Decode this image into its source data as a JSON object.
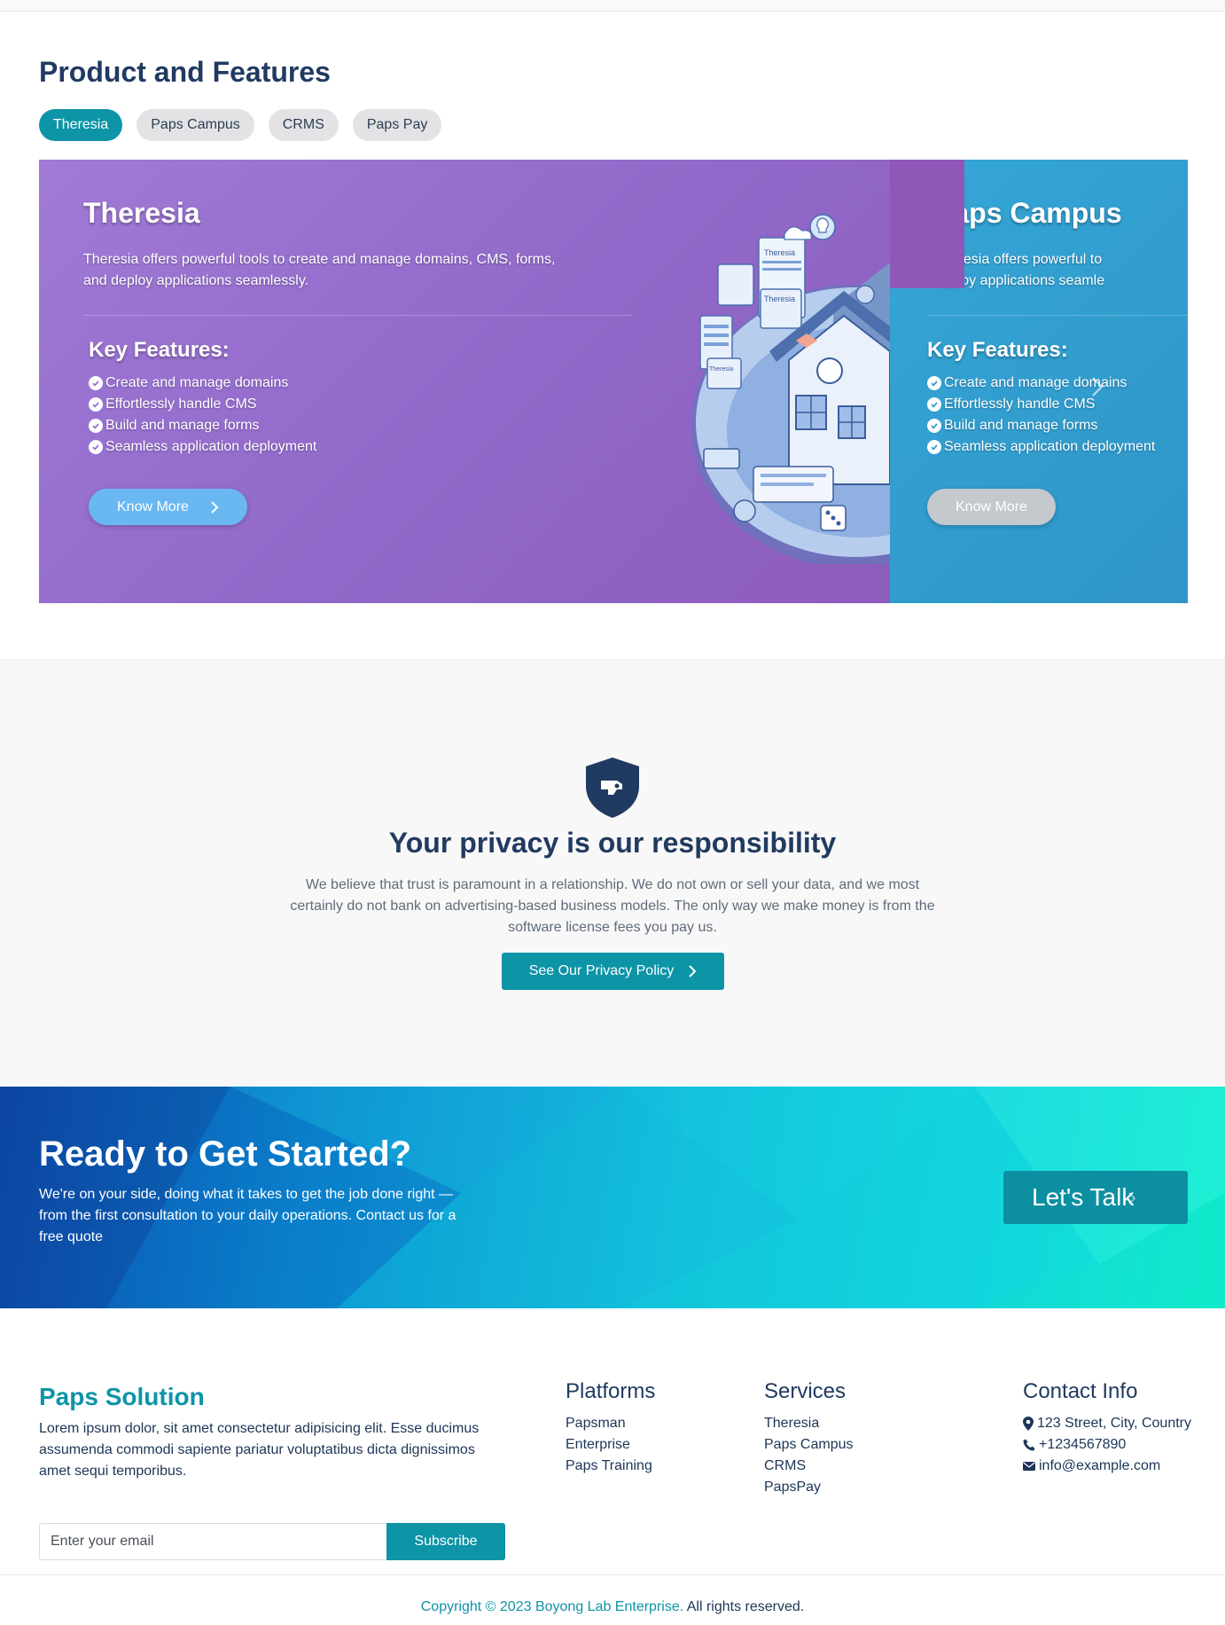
{
  "products": {
    "title": "Product and Features",
    "tabs": [
      {
        "label": "Theresia",
        "active": true
      },
      {
        "label": "Paps Campus",
        "active": false
      },
      {
        "label": "CRMS",
        "active": false
      },
      {
        "label": "Paps Pay",
        "active": false
      }
    ],
    "slides": [
      {
        "title": "Theresia",
        "description": "Theresia offers powerful tools to create and manage domains, CMS, forms, and deploy applications seamlessly.",
        "features_title": "Key Features:",
        "features": [
          "Create and manage domains",
          "Effortlessly handle CMS",
          "Build and manage forms",
          "Seamless application deployment"
        ],
        "button": "Know More",
        "color": "#9b6fd3"
      },
      {
        "title": "Paps Campus",
        "description_line1": "Theresia offers powerful to",
        "description_line2": "deploy applications seamle",
        "features_title": "Key Features:",
        "features": [
          "Create and manage domains",
          "Effortlessly handle CMS",
          "Build and manage forms",
          "Seamless application deployment"
        ],
        "button": "Know More",
        "color": "#309dcd"
      }
    ],
    "illustration_labels": [
      "Theresia",
      "Theresia",
      "Theresia"
    ]
  },
  "privacy": {
    "title": "Your privacy is our responsibility",
    "text": "We believe that trust is paramount in a relationship. We do not own or sell your data, and we most certainly do not bank on advertising-based business models. The only way we make money is from the software license fees you pay us.",
    "button": "See Our Privacy Policy",
    "icon": "shield-icon"
  },
  "cta": {
    "title": "Ready to Get Started?",
    "text": "We're on your side, doing what it takes to get the job done right — from the first consultation to your daily operations. Contact us for a free quote",
    "button": "Let's Talk"
  },
  "footer": {
    "brand": "Paps Solution",
    "description": "Lorem ipsum dolor, sit amet consectetur adipisicing elit. Esse ducimus assumenda commodi sapiente pariatur voluptatibus dicta dignissimos amet sequi temporibus.",
    "platforms": {
      "title": "Platforms",
      "items": [
        "Papsman",
        "Enterprise",
        "Paps Training"
      ]
    },
    "services": {
      "title": "Services",
      "items": [
        "Theresia",
        "Paps Campus",
        "CRMS",
        "PapsPay"
      ]
    },
    "contact": {
      "title": "Contact Info",
      "address": "123 Street, City, Country",
      "phone": "+1234567890",
      "email": "info@example.com"
    },
    "subscribe": {
      "placeholder": "Enter your email",
      "button": "Subscribe"
    },
    "copyright_link": "Copyright © 2023 Boyong Lab Enterprise.",
    "copyright_rest": " All rights reserved."
  },
  "colors": {
    "primary": "#0d94a7",
    "heading": "#213a61",
    "slide1": "#9b6fd3",
    "slide2": "#309dcd"
  }
}
